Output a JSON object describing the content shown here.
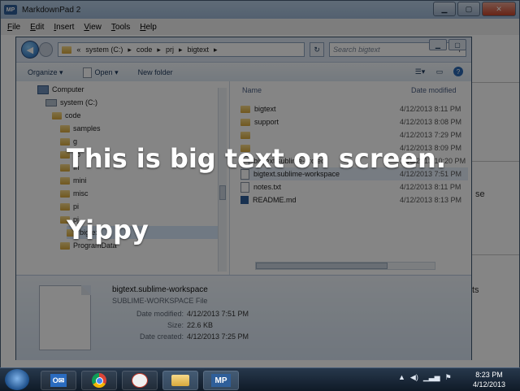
{
  "app": {
    "title": "MarkdownPad 2",
    "icon_label": "MP",
    "menu": [
      "File",
      "Edit",
      "Insert",
      "View",
      "Tools",
      "Help"
    ],
    "side_fragments": {
      "se": "se",
      "ts": "ts"
    }
  },
  "explorer": {
    "address": {
      "prefix": "«",
      "segments": [
        "system (C:)",
        "code",
        "prj",
        "bigtext"
      ],
      "sep": "▸"
    },
    "search_placeholder": "Search bigtext",
    "toolbar": {
      "organize": "Organize ▾",
      "open": "Open ▾",
      "new_folder": "New folder"
    },
    "tree": [
      {
        "label": "Computer",
        "icon": "computer-icon"
      },
      {
        "label": "system (C:)",
        "icon": "drive-icon"
      },
      {
        "label": "code",
        "icon": "folder-icon"
      },
      {
        "label": "samples",
        "icon": "folder-icon"
      },
      {
        "label": "g",
        "icon": "folder-icon"
      },
      {
        "label": "lib",
        "icon": "folder-icon"
      },
      {
        "label": "In",
        "icon": "folder-icon"
      },
      {
        "label": "mini",
        "icon": "folder-icon"
      },
      {
        "label": "misc",
        "icon": "folder-icon"
      },
      {
        "label": "pi",
        "icon": "folder-icon"
      },
      {
        "label": "pj",
        "icon": "folder-icon"
      },
      {
        "label": "bigtext",
        "icon": "folder-icon"
      },
      {
        "label": "ProgramData",
        "icon": "folder-icon"
      }
    ],
    "columns": {
      "name": "Name",
      "date": "Date modified"
    },
    "files": [
      {
        "name": "bigtext",
        "date": "4/12/2013 8:11 PM",
        "icon": "folder-icon"
      },
      {
        "name": "support",
        "date": "4/12/2013 8:08 PM",
        "icon": "folder-icon"
      },
      {
        "name": "",
        "date": "4/12/2013 7:29 PM",
        "icon": "folder-icon"
      },
      {
        "name": "",
        "date": "4/12/2013 8:09 PM",
        "icon": "folder-icon"
      },
      {
        "name": "bigtext.sublime-project",
        "date": "1/15/2013 10:20 PM",
        "icon": "file-icon"
      },
      {
        "name": "bigtext.sublime-workspace",
        "date": "4/12/2013 7:51 PM",
        "icon": "file-icon"
      },
      {
        "name": "notes.txt",
        "date": "4/12/2013 8:11 PM",
        "icon": "file-icon"
      },
      {
        "name": "README.md",
        "date": "4/12/2013 8:13 PM",
        "icon": "markdown-icon"
      }
    ],
    "details": {
      "filename": "bigtext.sublime-workspace",
      "type": "SUBLIME-WORKSPACE File",
      "modified_label": "Date modified:",
      "modified": "4/12/2013 7:51 PM",
      "size_label": "Size:",
      "size": "22.6 KB",
      "created_label": "Date created:",
      "created": "4/12/2013 7:25 PM"
    }
  },
  "overlay": {
    "line1": "This is big text on screen.",
    "line2": "Yippy"
  },
  "taskbar": {
    "time": "8:23 PM",
    "date": "4/12/2013",
    "mp_label": "MP"
  }
}
